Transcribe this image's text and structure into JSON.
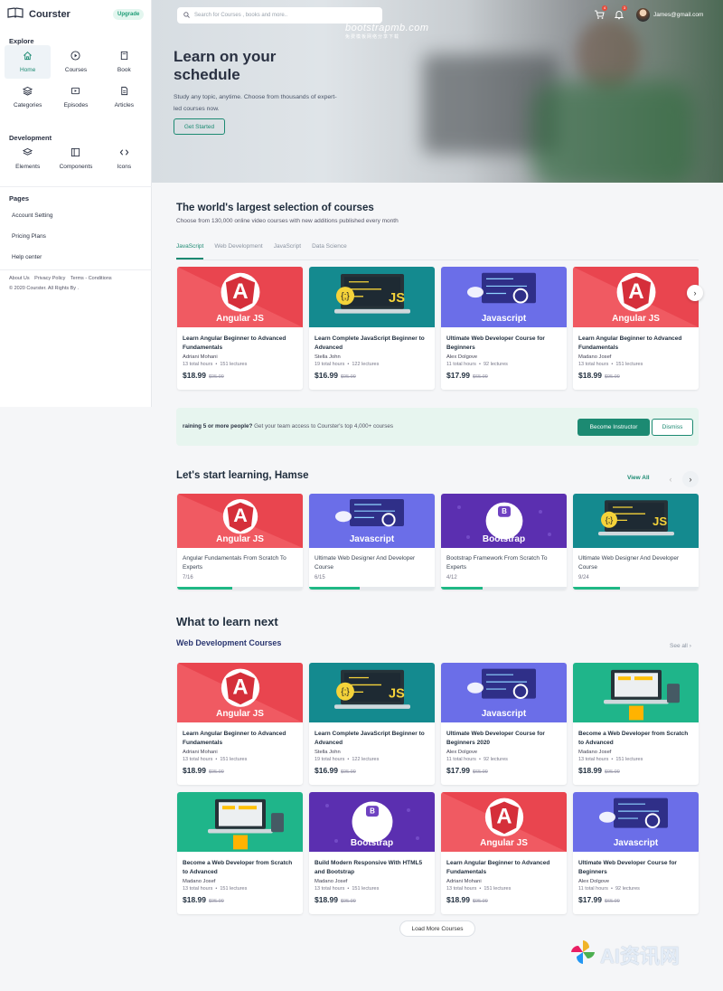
{
  "brand": {
    "name": "Courster",
    "upgrade": "Upgrade"
  },
  "sidebar": {
    "explore_title": "Explore",
    "explore": [
      {
        "label": "Home",
        "icon": "home-icon",
        "active": true
      },
      {
        "label": "Courses",
        "icon": "play-circle-icon"
      },
      {
        "label": "Book",
        "icon": "book-icon"
      },
      {
        "label": "Categories",
        "icon": "layers-icon"
      },
      {
        "label": "Episodes",
        "icon": "video-icon"
      },
      {
        "label": "Articles",
        "icon": "document-icon"
      }
    ],
    "development_title": "Development",
    "development": [
      {
        "label": "Elements",
        "icon": "layers-icon"
      },
      {
        "label": "Components",
        "icon": "columns-icon"
      },
      {
        "label": "Icons",
        "icon": "code-icon"
      }
    ],
    "pages_title": "Pages",
    "pages": [
      "Account Setting",
      "Pricing Plans",
      "Help center"
    ],
    "footer_links": [
      "About Us",
      "Privacy Policy",
      "Terms - Conditions"
    ],
    "copyright": "© 2020 Courster. All Rights By ."
  },
  "header": {
    "search_placeholder": "Search for Courses , books and more..",
    "watermark": "bootstrapmb.com",
    "watermark_sub": "免费模板网络分享下载",
    "cart_badge": "4",
    "bell_badge": "3",
    "user_email": "James@gmail.com"
  },
  "hero": {
    "title": "Learn on your schedule",
    "subtitle": "Study any topic, anytime. Choose from thousands of expert-led courses now.",
    "cta": "Get Started"
  },
  "selection": {
    "title": "The world's largest selection of courses",
    "subtitle": "Choose from 130,000 online video courses with new additions published every month",
    "tabs": [
      "JavaScript",
      "Web Development",
      "JavaScript",
      "Data Science"
    ],
    "cards": [
      {
        "thumb": "angular",
        "label": "Angular JS",
        "title": "Learn Angular Beginner to Advanced Fundamentals",
        "author": "Adriani Mohani",
        "hours": "13 total hours",
        "lectures": "151 lectures",
        "price": "$18.99",
        "old": "$95.99"
      },
      {
        "thumb": "js",
        "label": "",
        "title": "Learn Complete JavaScript Beginner to Advanced",
        "author": "Stella John",
        "hours": "19 total hours",
        "lectures": "122 lectures",
        "price": "$16.99",
        "old": "$95.99"
      },
      {
        "thumb": "javascript",
        "label": "Javascript",
        "title": "Ultimate Web Developer Course for Beginners",
        "author": "Alex Dolgove",
        "hours": "11 total hours",
        "lectures": "92 lectures",
        "price": "$17.99",
        "old": "$65.99"
      },
      {
        "thumb": "angular",
        "label": "Angular JS",
        "title": "Learn Angular Beginner to Advanced Fundamentals",
        "author": "Madano Josef",
        "hours": "13 total hours",
        "lectures": "151 lectures",
        "price": "$18.99",
        "old": "$95.99"
      }
    ]
  },
  "promo": {
    "bold": "raining 5 or more people?",
    "text": " Get your team access to Courster's top 4,000+ courses",
    "primary": "Become Instructor",
    "secondary": "Dismiss"
  },
  "learning": {
    "title": "Let's start learning, Hamse",
    "view_all": "View All",
    "cards": [
      {
        "thumb": "angular",
        "label": "Angular JS",
        "title": "Angular Fundamentals From Scratch To Experts",
        "progress": "7/16",
        "fraction": 0.4375
      },
      {
        "thumb": "javascript",
        "label": "Javascript",
        "title": "Ultimate Web Designer And Developer Course",
        "progress": "6/15",
        "fraction": 0.4
      },
      {
        "thumb": "bootstrap",
        "label": "Bootstrap",
        "title": "Bootstrap Framework From Scratch To Experts",
        "progress": "4/12",
        "fraction": 0.3333
      },
      {
        "thumb": "js",
        "label": "",
        "title": "Ultimate Web Designer And Developer Course",
        "progress": "9/24",
        "fraction": 0.375
      }
    ]
  },
  "next": {
    "title": "What to learn next",
    "subtitle": "Web Development Courses",
    "see_all": "See all",
    "row1": [
      {
        "thumb": "angular",
        "label": "Angular JS",
        "title": "Learn Angular Beginner to Advanced Fundamentals",
        "author": "Adriani Mohani",
        "hours": "13 total hours",
        "lectures": "151 lectures",
        "price": "$18.99",
        "old": "$95.99"
      },
      {
        "thumb": "js",
        "label": "",
        "title": "Learn Complete JavaScript Beginner to Advanced",
        "author": "Stella John",
        "hours": "19 total hours",
        "lectures": "122 lectures",
        "price": "$16.99",
        "old": "$95.99"
      },
      {
        "thumb": "javascript",
        "label": "Javascript",
        "title": "Ultimate Web Developer Course for Beginners 2020",
        "author": "Alex Dolgove",
        "hours": "11 total hours",
        "lectures": "92 lectures",
        "price": "$17.99",
        "old": "$65.99"
      },
      {
        "thumb": "webdev",
        "label": "",
        "title": "Become a Web Developer from Scratch to Advanced",
        "author": "Madano Josef",
        "hours": "13 total hours",
        "lectures": "151 lectures",
        "price": "$18.99",
        "old": "$95.99"
      }
    ],
    "row2": [
      {
        "thumb": "webdev",
        "label": "",
        "title": "Become a Web Developer from Scratch to Advanced",
        "author": "Madano Josef",
        "hours": "13 total hours",
        "lectures": "151 lectures",
        "price": "$18.99",
        "old": "$95.99"
      },
      {
        "thumb": "bootstrap",
        "label": "Bootstrap",
        "title": "Build Modern Responsive With HTML5 and Bootstrap",
        "author": "Madano Josef",
        "hours": "13 total hours",
        "lectures": "151 lectures",
        "price": "$18.99",
        "old": "$95.99"
      },
      {
        "thumb": "angular",
        "label": "Angular JS",
        "title": "Learn Angular Beginner to Advanced Fundamentals",
        "author": "Adriani Mohani",
        "hours": "13 total hours",
        "lectures": "151 lectures",
        "price": "$18.99",
        "old": "$95.99"
      },
      {
        "thumb": "javascript",
        "label": "Javascript",
        "title": "Ultimate Web Developer Course for Beginners",
        "author": "Alex Dolgove",
        "hours": "11 total hours",
        "lectures": "92 lectures",
        "price": "$17.99",
        "old": "$65.99"
      }
    ],
    "load_more": "Load More Courses"
  },
  "ai_badge": "AI资讯网",
  "colors": {
    "accent": "#1c8a72",
    "angular": "#e8434b",
    "teal": "#127f85",
    "purple": "#6a6ee8",
    "bootstrap": "#5b2fb0",
    "green": "#1fb885"
  }
}
